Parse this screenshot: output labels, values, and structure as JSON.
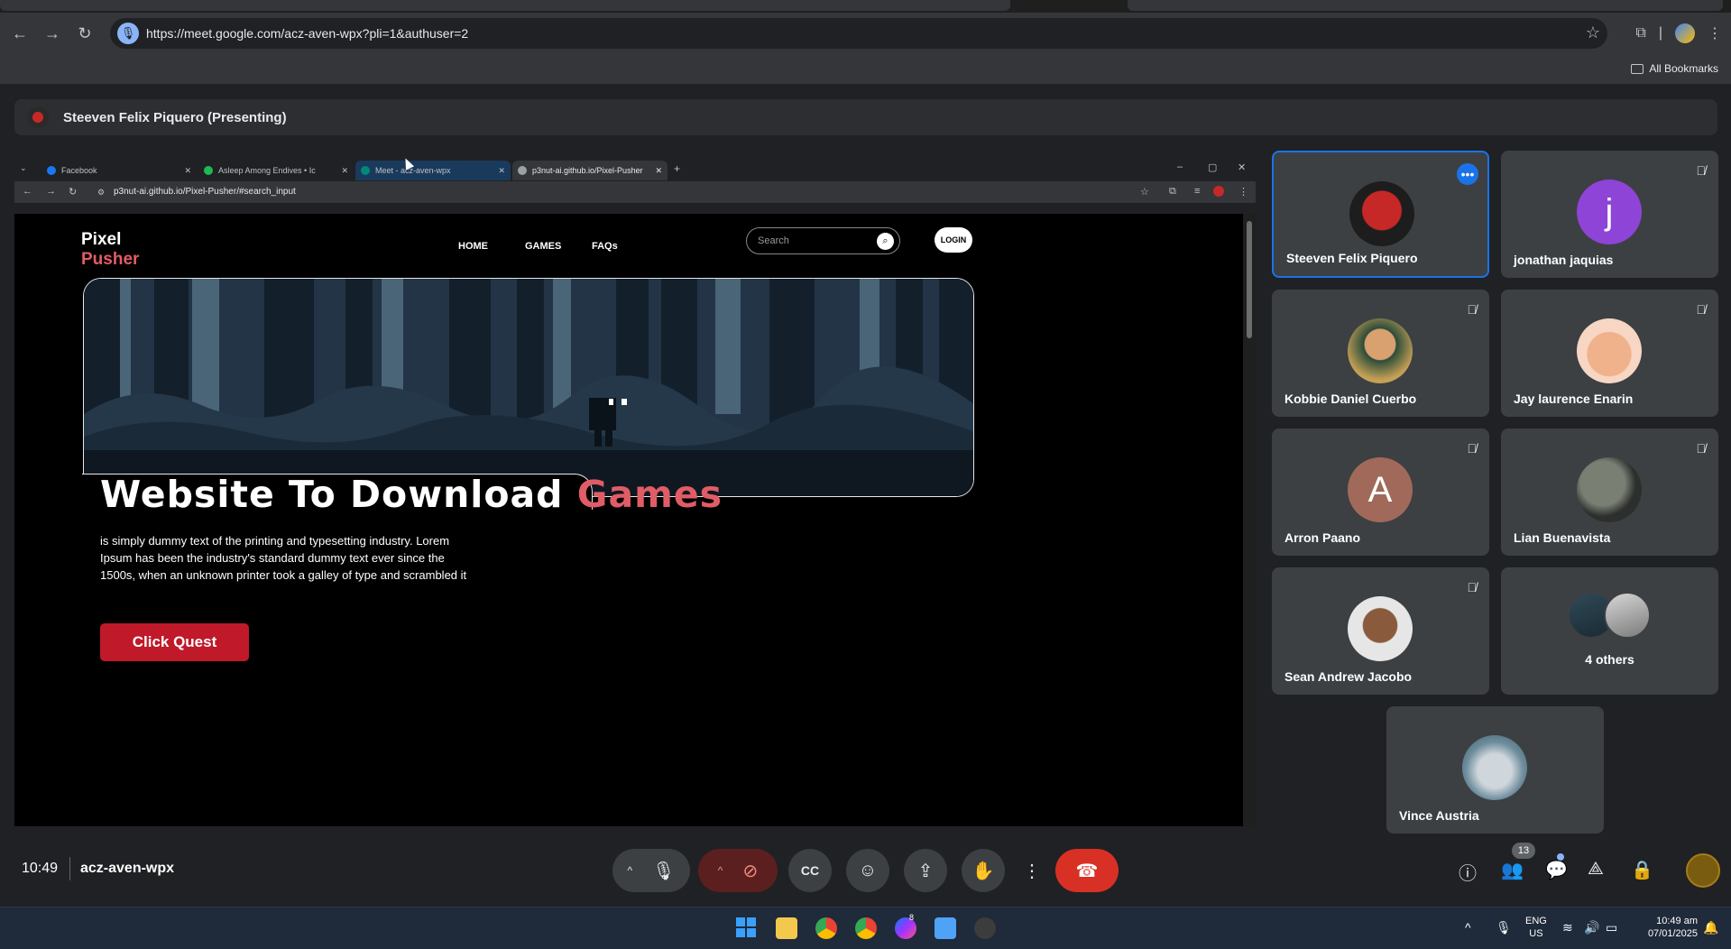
{
  "browser": {
    "url": "https://meet.google.com/acz-aven-wpx?pli=1&authuser=2",
    "bookmarks_label": "All Bookmarks"
  },
  "meet": {
    "presenting_title": "Steeven Felix Piquero (Presenting)",
    "time": "10:49",
    "meeting_code": "acz-aven-wpx",
    "participants_badge": "13"
  },
  "shared_screen": {
    "tabs": [
      {
        "label": "Facebook"
      },
      {
        "label": "Asleep Among Endives • Ic"
      },
      {
        "label": "Meet - acz-aven-wpx"
      },
      {
        "label": "p3nut-ai.github.io/Pixel-Pusher"
      }
    ],
    "url": "p3nut-ai.github.io/Pixel-Pusher/#search_input",
    "site": {
      "logo_line1": "Pixel",
      "logo_line2": "Pusher",
      "nav": [
        "HOME",
        "GAMES",
        "FAQs"
      ],
      "search_placeholder": "Search",
      "login_label": "LOGIN",
      "headline_main": "Website To Download ",
      "headline_accent": "Games",
      "description": "is simply dummy text of the printing and typesetting industry. Lorem Ipsum has been the industry's standard dummy text ever since the 1500s, when an unknown printer took a galley of type and scrambled it",
      "cta_label": "Click Quest"
    }
  },
  "participants": [
    {
      "name": "Steeven Felix Piquero"
    },
    {
      "name": "jonathan jaquias",
      "initial": "j"
    },
    {
      "name": "Kobbie Daniel Cuerbo"
    },
    {
      "name": "Jay laurence Enarin"
    },
    {
      "name": "Arron Paano",
      "initial": "A"
    },
    {
      "name": "Lian Buenavista"
    },
    {
      "name": "Sean Andrew Jacobo"
    },
    {
      "name": "4 others"
    },
    {
      "name": "Vince Austria"
    }
  ],
  "taskbar": {
    "lang_line1": "ENG",
    "lang_line2": "US",
    "time": "10:49 am",
    "date": "07/01/2025",
    "messenger_badge": "8"
  },
  "colors": {
    "accent_red": "#e05c66",
    "cta_red": "#c0192a",
    "meet_blue": "#1a73e8"
  }
}
